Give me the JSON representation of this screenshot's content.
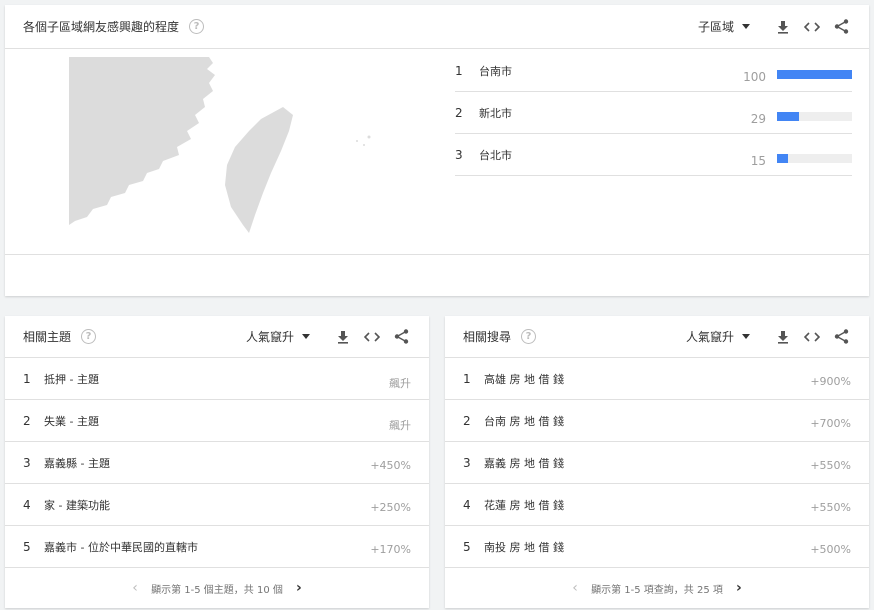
{
  "region_card": {
    "title": "各個子區域網友感興趣的程度",
    "help": "?",
    "selector": "子區域",
    "rows": [
      {
        "rank": "1",
        "name": "台南市",
        "value": "100",
        "fraction": 1.0
      },
      {
        "rank": "2",
        "name": "新北市",
        "value": "29",
        "fraction": 0.29
      },
      {
        "rank": "3",
        "name": "台北市",
        "value": "15",
        "fraction": 0.15
      }
    ],
    "colors": {
      "bar": "#4285f4",
      "track": "#eeeeee",
      "map": "#dcdcdc"
    }
  },
  "topics_card": {
    "title": "相關主題",
    "help": "?",
    "selector": "人氣竄升",
    "rows": [
      {
        "rank": "1",
        "label": "抵押 - 主題",
        "value": "飆升"
      },
      {
        "rank": "2",
        "label": "失業 - 主題",
        "value": "飆升"
      },
      {
        "rank": "3",
        "label": "嘉義縣 - 主題",
        "value": "+450%"
      },
      {
        "rank": "4",
        "label": "家 - 建築功能",
        "value": "+250%"
      },
      {
        "rank": "5",
        "label": "嘉義市 - 位於中華民國的直轄市",
        "value": "+170%"
      }
    ],
    "pager": "顯示第 1-5 個主題，共 10 個"
  },
  "queries_card": {
    "title": "相關搜尋",
    "help": "?",
    "selector": "人氣竄升",
    "rows": [
      {
        "rank": "1",
        "label": "高雄 房 地 借 錢",
        "value": "+900%"
      },
      {
        "rank": "2",
        "label": "台南 房 地 借 錢",
        "value": "+700%"
      },
      {
        "rank": "3",
        "label": "嘉義 房 地 借 錢",
        "value": "+550%"
      },
      {
        "rank": "4",
        "label": "花蓮 房 地 借 錢",
        "value": "+550%"
      },
      {
        "rank": "5",
        "label": "南投 房 地 借 錢",
        "value": "+500%"
      }
    ],
    "pager": "顯示第 1-5 項查詢，共 25 項"
  },
  "icons": {
    "download": "download-icon",
    "embed": "embed-code-icon",
    "share": "share-icon",
    "dropdown": "dropdown-arrow-icon",
    "prev": "chevron-left-icon",
    "next": "chevron-right-icon"
  }
}
